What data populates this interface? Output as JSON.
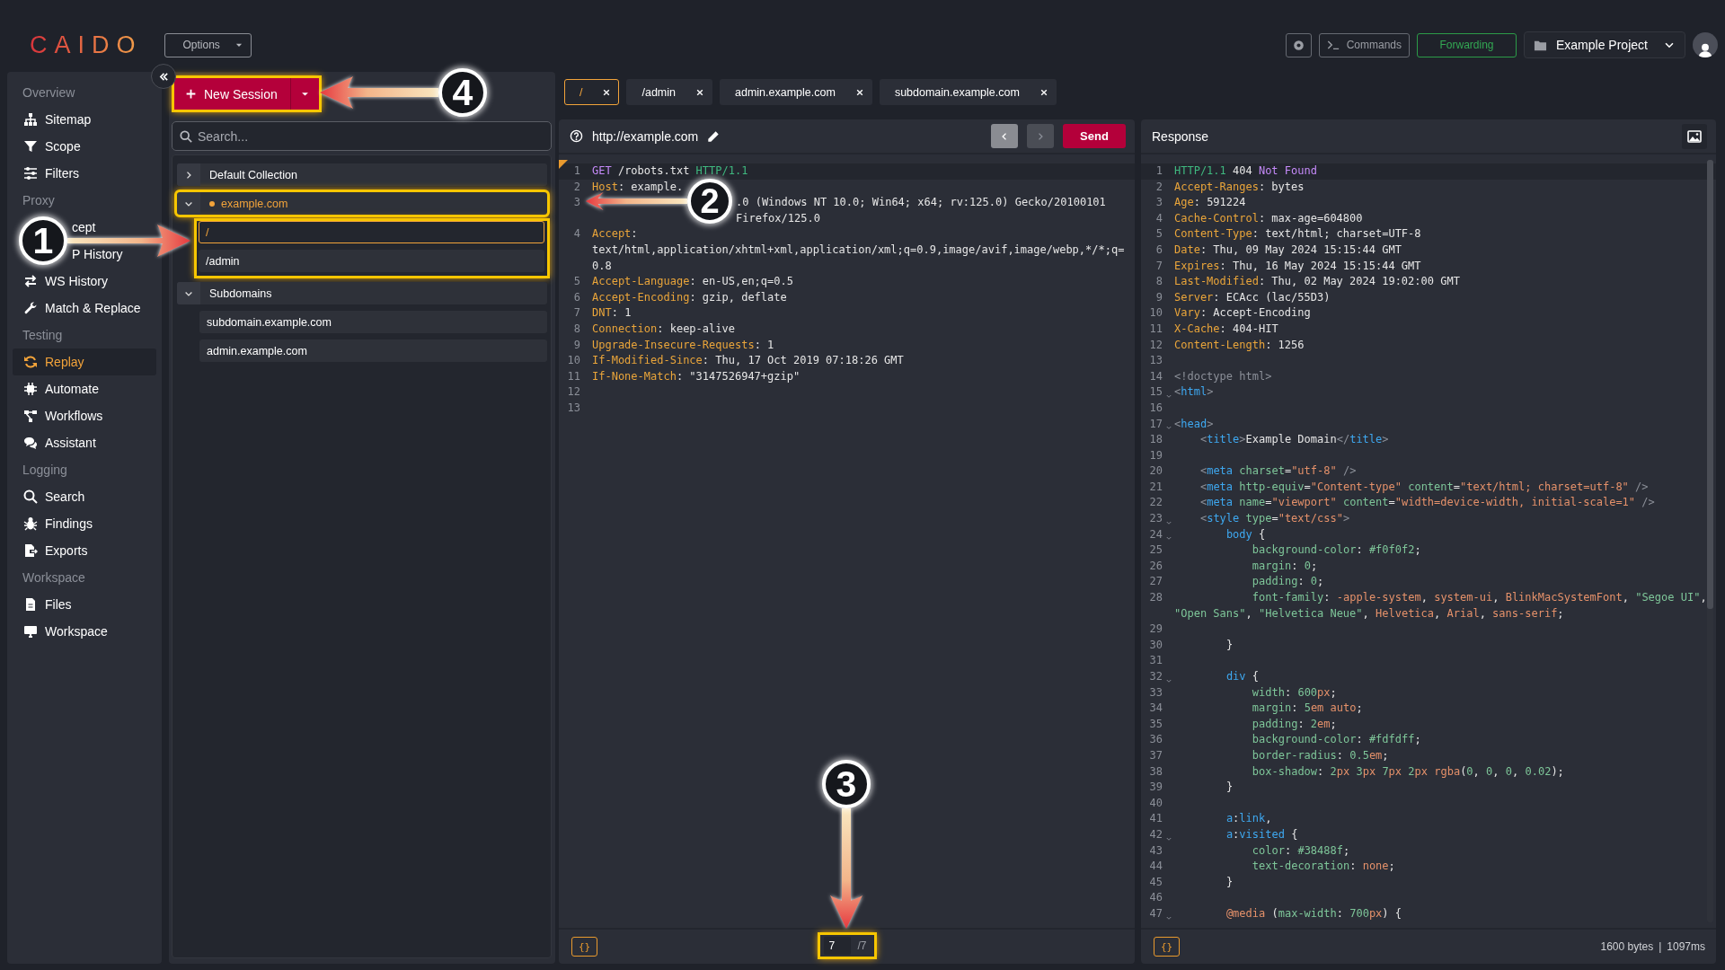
{
  "topbar": {
    "logo": "CAIDO",
    "options": "Options",
    "commands": "Commands",
    "forwarding": "Forwarding",
    "project": "Example Project"
  },
  "sidebar": {
    "sections": [
      {
        "title": "Overview",
        "items": [
          {
            "label": "Sitemap",
            "kind": "normal",
            "selected": false
          },
          {
            "label": "Scope",
            "kind": "normal",
            "selected": false
          },
          {
            "label": "Filters",
            "kind": "normal",
            "selected": false
          }
        ]
      },
      {
        "title": "Proxy",
        "items": [
          {
            "label": "cept",
            "kind": "partial",
            "selected": false
          },
          {
            "label": "P History",
            "kind": "partial",
            "selected": false
          },
          {
            "label": "WS History",
            "kind": "normal",
            "selected": false
          },
          {
            "label": "Match & Replace",
            "kind": "normal",
            "selected": false
          }
        ]
      },
      {
        "title": "Testing",
        "items": [
          {
            "label": "Replay",
            "kind": "normal",
            "selected": true
          },
          {
            "label": "Automate",
            "kind": "normal",
            "selected": false
          },
          {
            "label": "Workflows",
            "kind": "normal",
            "selected": false
          },
          {
            "label": "Assistant",
            "kind": "normal",
            "selected": false
          }
        ]
      },
      {
        "title": "Logging",
        "items": [
          {
            "label": "Search",
            "kind": "normal",
            "selected": false
          },
          {
            "label": "Findings",
            "kind": "normal",
            "selected": false
          },
          {
            "label": "Exports",
            "kind": "normal",
            "selected": false
          }
        ]
      },
      {
        "title": "Workspace",
        "items": [
          {
            "label": "Files",
            "kind": "normal",
            "selected": false
          },
          {
            "label": "Workspace",
            "kind": "normal",
            "selected": false
          }
        ]
      }
    ]
  },
  "collections": {
    "new_session": {
      "label": "New Session",
      "highlighted": true
    },
    "search": {
      "placeholder": "Search..."
    },
    "tree": [
      {
        "label": "Default Collection",
        "expanded": false,
        "active": false,
        "highlighted": false
      },
      {
        "label": "example.com",
        "expanded": true,
        "active": true,
        "highlighted": true,
        "children_highlighted": true,
        "children": [
          {
            "label": "/",
            "selected": true
          },
          {
            "label": "/admin",
            "selected": false
          }
        ]
      },
      {
        "label": "Subdomains",
        "expanded": true,
        "active": false,
        "highlighted": false,
        "children_highlighted": false,
        "children": [
          {
            "label": "subdomain.example.com",
            "selected": false
          },
          {
            "label": "admin.example.com",
            "selected": false
          }
        ]
      }
    ]
  },
  "tabs": [
    {
      "label": "/",
      "selected": true
    },
    {
      "label": "/admin",
      "selected": false
    },
    {
      "label": "admin.example.com",
      "selected": false
    },
    {
      "label": "subdomain.example.com",
      "selected": false
    }
  ],
  "request": {
    "url": "http://example.com",
    "send": "Send",
    "modified": true,
    "nav": [
      {
        "kind": "back",
        "disabled": false
      },
      {
        "kind": "forward",
        "disabled": true
      }
    ],
    "lines": [
      {
        "n": "1",
        "text": "GET /robots.txt HTTP/1.1",
        "kind": "start",
        "current": true
      },
      {
        "n": "2",
        "text": "Host: example.",
        "kind": "header",
        "current": false
      },
      {
        "n": "3",
        "text": ".0 (Windows NT 10.0; Win64; x64; rv:125.0) Gecko/20100101 Firefox/125.0",
        "kind": "partial",
        "current": false
      },
      {
        "n": "4",
        "text": "Accept: text/html,application/xhtml+xml,application/xml;q=0.9,image/avif,image/webp,*/*;q=0.8",
        "kind": "header",
        "current": false
      },
      {
        "n": "5",
        "text": "Accept-Language: en-US,en;q=0.5",
        "kind": "header",
        "current": false
      },
      {
        "n": "6",
        "text": "Accept-Encoding: gzip, deflate",
        "kind": "header",
        "current": false
      },
      {
        "n": "7",
        "text": "DNT: 1",
        "kind": "header",
        "current": false
      },
      {
        "n": "8",
        "text": "Connection: keep-alive",
        "kind": "header",
        "current": false
      },
      {
        "n": "9",
        "text": "Upgrade-Insecure-Requests: 1",
        "kind": "header",
        "current": false
      },
      {
        "n": "10",
        "text": "If-Modified-Since: Thu, 17 Oct 2019 07:18:26 GMT",
        "kind": "header",
        "current": false
      },
      {
        "n": "11",
        "text": "If-None-Match: \"3147526947+gzip\"",
        "kind": "header",
        "current": false
      },
      {
        "n": "12",
        "kind": "blank",
        "current": false
      },
      {
        "n": "13",
        "kind": "blank",
        "current": false
      }
    ],
    "format_button": "{}",
    "page": {
      "current": "7",
      "total": "/7",
      "highlighted": true
    }
  },
  "response": {
    "title": "Response",
    "lines": [
      {
        "n": "1",
        "text": "HTTP/1.1 404 Not Found",
        "kind": "status",
        "current": true,
        "foldable": false
      },
      {
        "n": "2",
        "text": "Accept-Ranges: bytes",
        "kind": "header",
        "current": false,
        "foldable": false
      },
      {
        "n": "3",
        "text": "Age: 591224",
        "kind": "header",
        "current": false,
        "foldable": false
      },
      {
        "n": "4",
        "text": "Cache-Control: max-age=604800",
        "kind": "header",
        "current": false,
        "foldable": false
      },
      {
        "n": "5",
        "text": "Content-Type: text/html; charset=UTF-8",
        "kind": "header",
        "current": false,
        "foldable": false
      },
      {
        "n": "6",
        "text": "Date: Thu, 09 May 2024 15:15:44 GMT",
        "kind": "header",
        "current": false,
        "foldable": false
      },
      {
        "n": "7",
        "text": "Expires: Thu, 16 May 2024 15:15:44 GMT",
        "kind": "header",
        "current": false,
        "foldable": false
      },
      {
        "n": "8",
        "text": "Last-Modified: Thu, 02 May 2024 19:02:00 GMT",
        "kind": "header",
        "current": false,
        "foldable": false
      },
      {
        "n": "9",
        "text": "Server: ECAcc (lac/55D3)",
        "kind": "header",
        "current": false,
        "foldable": false
      },
      {
        "n": "10",
        "text": "Vary: Accept-Encoding",
        "kind": "header",
        "current": false,
        "foldable": false
      },
      {
        "n": "11",
        "text": "X-Cache: 404-HIT",
        "kind": "header",
        "current": false,
        "foldable": false
      },
      {
        "n": "12",
        "text": "Content-Length: 1256",
        "kind": "header",
        "current": false,
        "foldable": false
      },
      {
        "n": "13",
        "kind": "blank",
        "current": false,
        "foldable": false
      },
      {
        "n": "14",
        "text": "<!doctype html>",
        "kind": "markup",
        "current": false,
        "foldable": false
      },
      {
        "n": "15",
        "text": "<html>",
        "kind": "markup",
        "current": false,
        "foldable": true
      },
      {
        "n": "16",
        "kind": "blank",
        "current": false,
        "foldable": false
      },
      {
        "n": "17",
        "text": "<head>",
        "kind": "markup",
        "current": false,
        "foldable": true
      },
      {
        "n": "18",
        "text": "    <title>Example Domain</title>",
        "kind": "markup",
        "current": false,
        "foldable": false
      },
      {
        "n": "19",
        "kind": "blank",
        "current": false,
        "foldable": false
      },
      {
        "n": "20",
        "text": "    <meta charset=\"utf-8\" />",
        "kind": "markup",
        "current": false,
        "foldable": false
      },
      {
        "n": "21",
        "text": "    <meta http-equiv=\"Content-type\" content=\"text/html; charset=utf-8\" />",
        "kind": "markup",
        "current": false,
        "foldable": false
      },
      {
        "n": "22",
        "text": "    <meta name=\"viewport\" content=\"width=device-width, initial-scale=1\" />",
        "kind": "markup",
        "current": false,
        "foldable": false
      },
      {
        "n": "23",
        "text": "    <style type=\"text/css\">",
        "kind": "markup",
        "current": false,
        "foldable": true
      },
      {
        "n": "24",
        "text": "        body {",
        "kind": "selector",
        "current": false,
        "foldable": true
      },
      {
        "n": "25",
        "text": "            background-color: #f0f0f2;",
        "kind": "css",
        "current": false,
        "foldable": false
      },
      {
        "n": "26",
        "text": "            margin: 0;",
        "kind": "css",
        "current": false,
        "foldable": false
      },
      {
        "n": "27",
        "text": "            padding: 0;",
        "kind": "css",
        "current": false,
        "foldable": false
      },
      {
        "n": "28",
        "text": "            font-family: -apple-system, system-ui, BlinkMacSystemFont, \"Segoe UI\", \"Open Sans\", \"Helvetica Neue\", Helvetica, Arial, sans-serif;",
        "kind": "css",
        "current": false,
        "foldable": false
      },
      {
        "n": "29",
        "kind": "blank",
        "current": false,
        "foldable": false
      },
      {
        "n": "30",
        "text": "        }",
        "kind": "css",
        "current": false,
        "foldable": false
      },
      {
        "n": "31",
        "kind": "blank",
        "current": false,
        "foldable": false
      },
      {
        "n": "32",
        "text": "        div {",
        "kind": "selector",
        "current": false,
        "foldable": true
      },
      {
        "n": "33",
        "text": "            width: 600px;",
        "kind": "css",
        "current": false,
        "foldable": false
      },
      {
        "n": "34",
        "text": "            margin: 5em auto;",
        "kind": "css",
        "current": false,
        "foldable": false
      },
      {
        "n": "35",
        "text": "            padding: 2em;",
        "kind": "css",
        "current": false,
        "foldable": false
      },
      {
        "n": "36",
        "text": "            background-color: #fdfdff;",
        "kind": "css",
        "current": false,
        "foldable": false
      },
      {
        "n": "37",
        "text": "            border-radius: 0.5em;",
        "kind": "css",
        "current": false,
        "foldable": false
      },
      {
        "n": "38",
        "text": "            box-shadow: 2px 3px 7px 2px rgba(0, 0, 0, 0.02);",
        "kind": "css",
        "current": false,
        "foldable": false
      },
      {
        "n": "39",
        "text": "        }",
        "kind": "css",
        "current": false,
        "foldable": false
      },
      {
        "n": "40",
        "kind": "blank",
        "current": false,
        "foldable": false
      },
      {
        "n": "41",
        "text": "        a:link,",
        "kind": "selector",
        "current": false,
        "foldable": false
      },
      {
        "n": "42",
        "text": "        a:visited {",
        "kind": "selector",
        "current": false,
        "foldable": true
      },
      {
        "n": "43",
        "text": "            color: #38488f;",
        "kind": "css",
        "current": false,
        "foldable": false
      },
      {
        "n": "44",
        "text": "            text-decoration: none;",
        "kind": "css",
        "current": false,
        "foldable": false
      },
      {
        "n": "45",
        "text": "        }",
        "kind": "css",
        "current": false,
        "foldable": false
      },
      {
        "n": "46",
        "kind": "blank",
        "current": false,
        "foldable": false
      },
      {
        "n": "47",
        "text": "        @media (max-width: 700px) {",
        "kind": "css",
        "current": false,
        "foldable": true
      }
    ],
    "format_button": "{}",
    "size": "1600 bytes",
    "separator": "|",
    "time": "1097ms"
  },
  "annotations": [
    {
      "label": "4"
    },
    {
      "label": "2"
    },
    {
      "label": "1"
    },
    {
      "label": "3"
    }
  ]
}
